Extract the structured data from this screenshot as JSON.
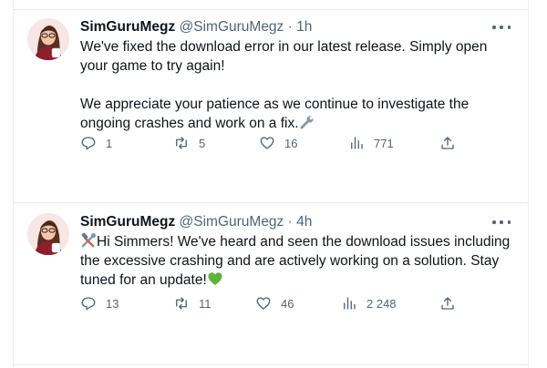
{
  "tweets": [
    {
      "name": "SimGuruMegz",
      "handle": "@SimGuruMegz",
      "separator": "·",
      "time": "1h",
      "paragraphs": [
        "We've fixed the download error in our latest release. Simply open your game to try again!",
        "We appreciate your patience as we continue to investigate the ongoing crashes and work on a fix."
      ],
      "trailing_emoji": "wrench-icon",
      "replies": "1",
      "retweets": "5",
      "likes": "16",
      "views": "771"
    },
    {
      "name": "SimGuruMegz",
      "handle": "@SimGuruMegz",
      "separator": "·",
      "time": "4h",
      "leading_emoji": "hammer-and-wrench-icon",
      "text": "Hi Simmers! We've heard and seen the download issues including the excessive crashing and are actively working on a solution. Stay tuned for an update!",
      "trailing_emoji": "green-heart-icon",
      "replies": "13",
      "retweets": "11",
      "likes": "46",
      "views": "2 248"
    }
  ],
  "colors": {
    "text": "#0f1419",
    "muted": "#536471",
    "divider": "#e9ecef",
    "heart_emoji": "#5fb23a"
  }
}
